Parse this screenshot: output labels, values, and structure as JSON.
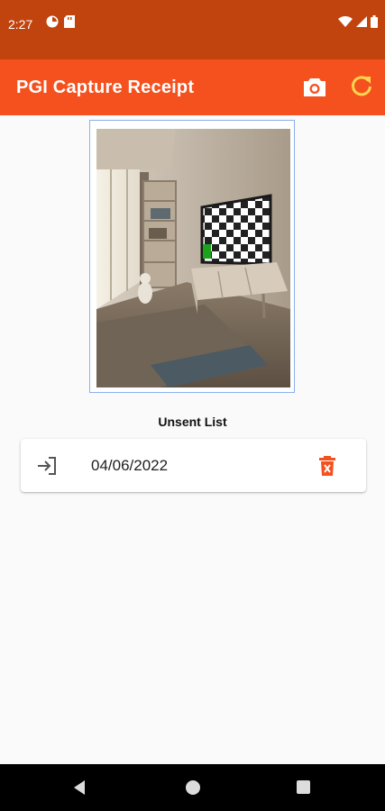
{
  "status_bar": {
    "time": "2:27",
    "left_icons": [
      "notification-icon",
      "sd-card-icon"
    ],
    "right_icons": [
      "wifi-icon",
      "signal-icon",
      "battery-icon"
    ],
    "color": "#c1440e"
  },
  "app_bar": {
    "title": "PGI Capture Receipt",
    "actions": [
      "camera-icon",
      "refresh-icon"
    ],
    "color": "#f4511e",
    "refresh_icon_color": "#ffd54f"
  },
  "preview": {
    "icon": "receipt-photo"
  },
  "unsent_list": {
    "title": "Unsent List",
    "items": [
      {
        "icon": "login-icon",
        "date": "04/06/2022",
        "action_icon": "delete-icon"
      }
    ],
    "delete_color": "#f4511e"
  },
  "nav_bar": {
    "buttons": [
      "back-icon",
      "home-icon",
      "recents-icon"
    ]
  }
}
